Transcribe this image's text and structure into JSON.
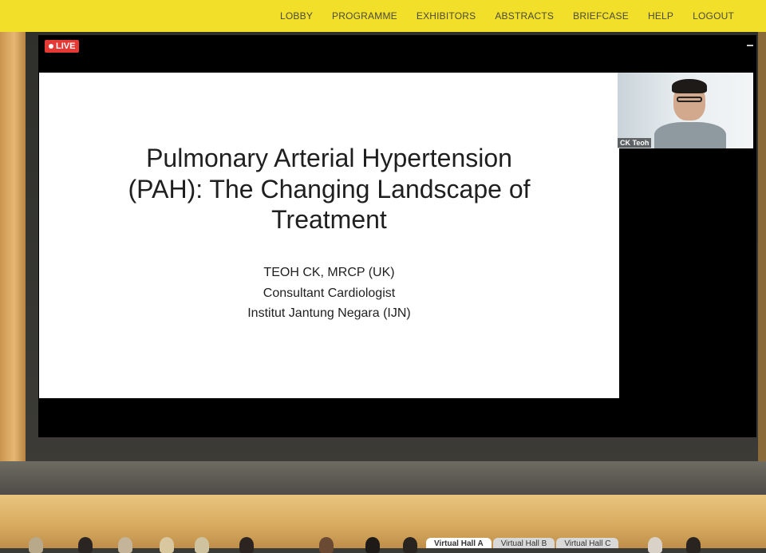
{
  "nav": {
    "items": [
      "LOBBY",
      "PROGRAMME",
      "EXHIBITORS",
      "ABSTRACTS",
      "BRIEFCASE",
      "HELP",
      "LOGOUT"
    ]
  },
  "stream": {
    "live_label": "LIVE"
  },
  "slide": {
    "title_lines": [
      "Pulmonary Arterial Hypertension",
      "(PAH): The Changing Landscape of",
      "Treatment"
    ],
    "author_lines": [
      "TEOH CK, MRCP (UK)",
      "Consultant Cardiologist",
      "Institut Jantung Negara (IJN)"
    ]
  },
  "speaker_tile": {
    "name": "CK Teoh"
  },
  "hall_tabs": {
    "items": [
      "Virtual Hall A",
      "Virtual Hall B",
      "Virtual Hall C"
    ],
    "active_index": 0
  },
  "colors": {
    "nav_bar": "#f2df2a",
    "live_badge": "#e53935",
    "wood": "#e6b772"
  }
}
